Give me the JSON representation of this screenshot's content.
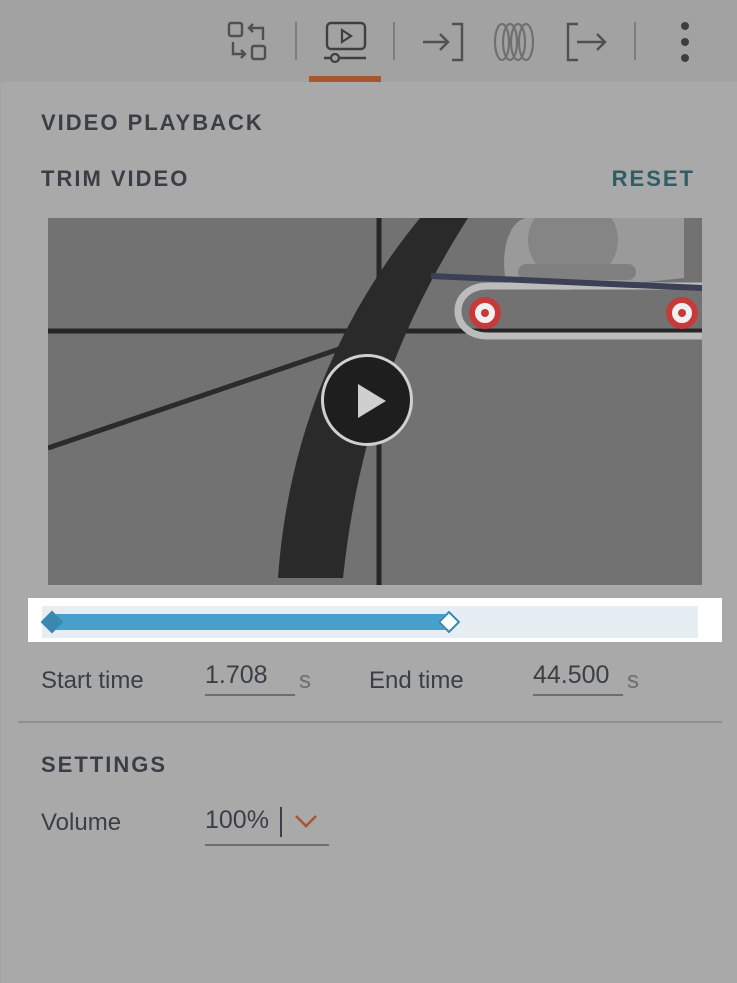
{
  "toolbar": {
    "icons": [
      "swap-layout-icon",
      "video-settings-icon",
      "enter-icon",
      "rings-icon",
      "exit-icon",
      "more-vertical-icon"
    ],
    "accent_color": "#a9562f"
  },
  "panel": {
    "title": "VIDEO PLAYBACK",
    "trim": {
      "title": "TRIM VIDEO",
      "reset_label": "RESET",
      "start_label": "Start time",
      "start_value": "1.708",
      "end_label": "End time",
      "end_value": "44.500",
      "unit": "s",
      "selection_start_fraction": 0.0,
      "selection_end_fraction": 0.62,
      "track_color": "#47a0cc"
    },
    "settings": {
      "title": "SETTINGS",
      "volume_label": "Volume",
      "volume_value": "100%"
    }
  }
}
